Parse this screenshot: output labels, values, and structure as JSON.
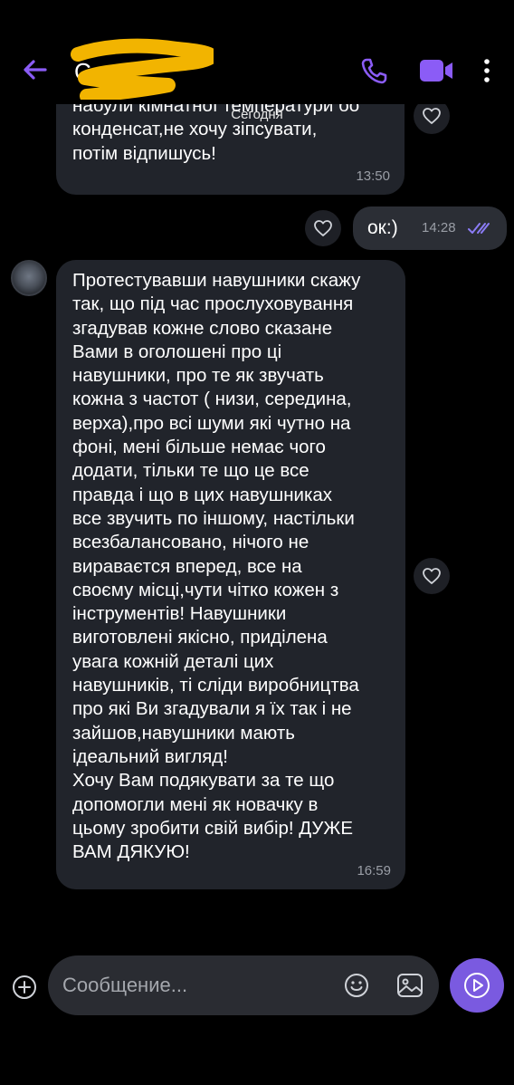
{
  "header": {
    "contact_name": "С",
    "accent": "#8b5cf6"
  },
  "chat": {
    "date_label": "Сегодня",
    "messages": [
      {
        "direction": "incoming",
        "text": "набули кімнатної температури бо\nконденсат,не хочу зіпсувати,\nпотім відпишусь!",
        "time": "13:50"
      },
      {
        "direction": "outgoing",
        "text": "ок:)",
        "time": "14:28",
        "status": "read"
      },
      {
        "direction": "incoming",
        "text": "Протестувавши навушники скажу\nтак, що під час прослуховування\nзгадував кожне слово сказане\nВами в оголошені про ці\nнавушники, про те як звучать\nкожна з частот ( низи, середина,\nверха),про всі шуми які чутно на\nфоні, мені більше немає чого\nдодати, тільки те що це все\nправда і що в цих навушниках\nвсе звучить по іншому, настільки\nвсезбалансовано, нічого не\nвираваєтся вперед, все на\nсвоєму місці,чути чітко кожен з\nінструментів! Навушники\nвиготовлені якісно, приділена\nувага кожній деталі цих\nнавушників, ті сліди виробництва\nпро які Ви згадували я їх так і не\nзайшов,навушники мають\nідеальний вигляд!\nХочу Вам подякувати за те що\nдопомогли мені як новачку в\nцьому зробити свій вибір! ДУЖЕ\nВАМ ДЯКУЮ!",
        "time": "16:59"
      }
    ]
  },
  "composer": {
    "placeholder": "Сообщение...",
    "send_color": "#7a5ae0"
  }
}
